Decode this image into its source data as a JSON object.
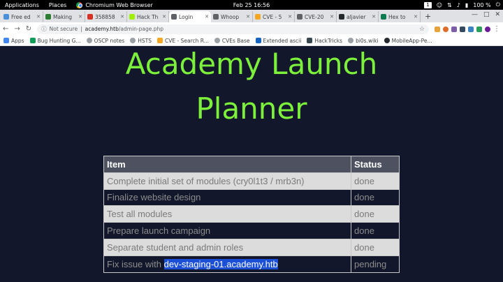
{
  "topbar": {
    "applications": "Applications",
    "places": "Places",
    "browser": "Chromium Web Browser",
    "clock": "Feb 25  16:56",
    "workspace": "1",
    "battery": "100 %"
  },
  "tabs": [
    {
      "title": "Free ed",
      "color": "#4a90d9"
    },
    {
      "title": "Making",
      "color": "#2e7d32"
    },
    {
      "title": "358858",
      "color": "#d93025"
    },
    {
      "title": "Hack Th",
      "color": "#9fef00"
    },
    {
      "title": "Login",
      "color": "#5f6368",
      "active": true
    },
    {
      "title": "Whoop",
      "color": "#5f6368"
    },
    {
      "title": "CVE - 5",
      "color": "#f5a623"
    },
    {
      "title": "CVE-20",
      "color": "#5f6368"
    },
    {
      "title": "aljavier",
      "color": "#24292e"
    },
    {
      "title": "Hex to",
      "color": "#0a7c50"
    }
  ],
  "toolbar": {
    "not_secure": "Not secure",
    "url_host": "academy.htb",
    "url_path": "/admin-page.php"
  },
  "bookmarks": [
    {
      "label": "Apps",
      "color": "#4285f4"
    },
    {
      "label": "Bug Hunting G...",
      "color": "#0f9d58"
    },
    {
      "label": "OSCP notes",
      "color": "#5f6368"
    },
    {
      "label": "HSTS",
      "color": "#5f6368"
    },
    {
      "label": "CVE - Search R...",
      "color": "#f5a623"
    },
    {
      "label": "CVEs Base",
      "color": "#5f6368"
    },
    {
      "label": "Extended ascii",
      "color": "#1565c0"
    },
    {
      "label": "HackTricks",
      "color": "#37474f"
    },
    {
      "label": "bi0s.wiki",
      "color": "#5f6368"
    },
    {
      "label": "MobileApp-Pe...",
      "color": "#24292e"
    }
  ],
  "page": {
    "title_line1": "Academy Launch",
    "title_line2": "Planner",
    "headers": {
      "item": "Item",
      "status": "Status"
    },
    "rows": [
      {
        "item": "Complete initial set of modules (cry0l1t3 / mrb3n)",
        "status": "done"
      },
      {
        "item": "Finalize website design",
        "status": "done"
      },
      {
        "item": "Test all modules",
        "status": "done"
      },
      {
        "item": "Prepare launch campaign",
        "status": "done"
      },
      {
        "item": "Separate student and admin roles",
        "status": "done"
      },
      {
        "item_prefix": "Fix issue with ",
        "item_highlight": "dev-staging-01.academy.htb",
        "status": "pending"
      }
    ]
  }
}
